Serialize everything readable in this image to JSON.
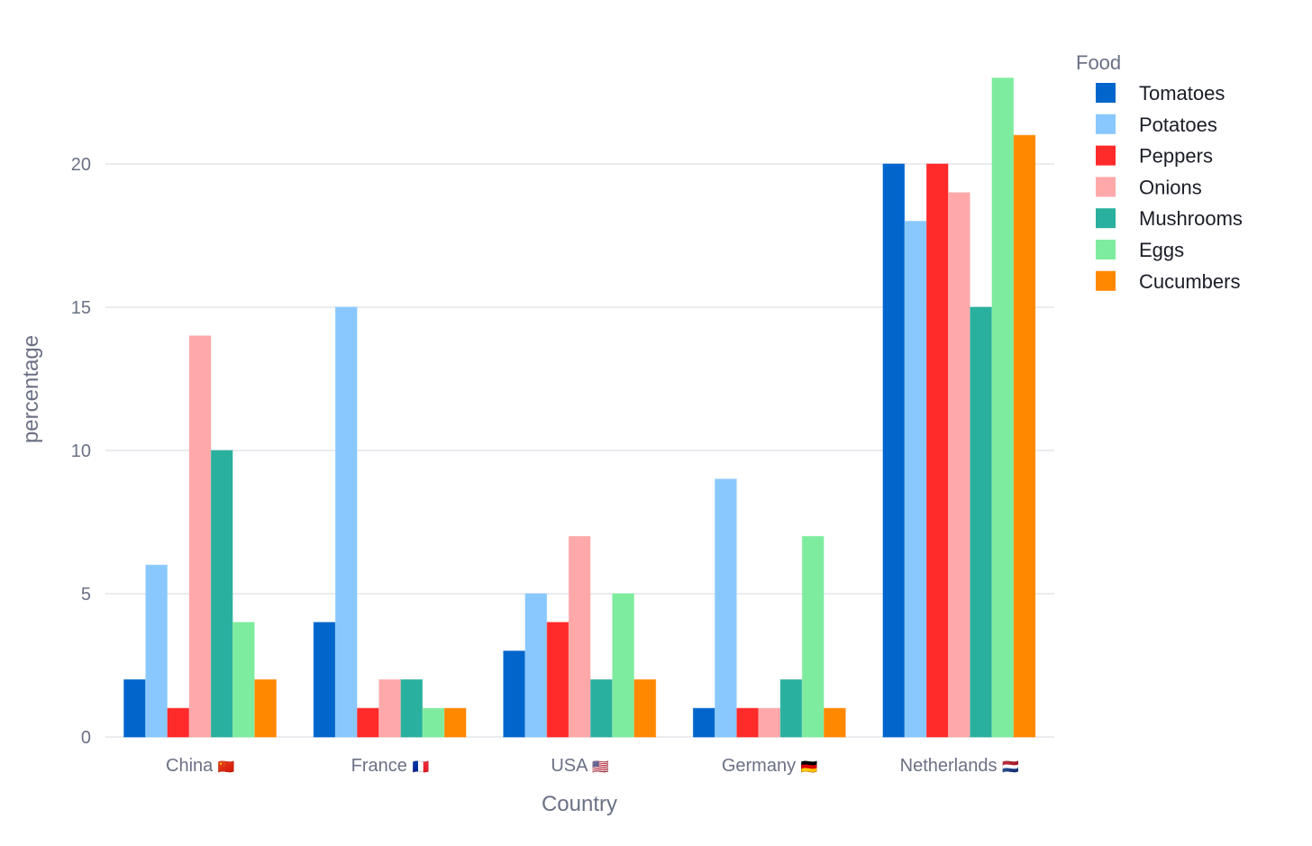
{
  "chart_data": {
    "type": "bar",
    "title": "",
    "xlabel": "Country",
    "ylabel": "percentage",
    "ylim": [
      0,
      23.5
    ],
    "yticks": [
      0,
      5,
      10,
      15,
      20
    ],
    "grid": true,
    "legend_title": "Food",
    "legend_position": "top-right",
    "categories": [
      "China",
      "France",
      "USA",
      "Germany",
      "Netherlands"
    ],
    "category_flags": [
      "🇨🇳",
      "🇫🇷",
      "🇺🇸",
      "🇩🇪",
      "🇳🇱"
    ],
    "series": [
      {
        "name": "Tomatoes",
        "color": "#0066cc",
        "values": [
          2,
          4,
          3,
          1,
          20
        ]
      },
      {
        "name": "Potatoes",
        "color": "#88c8ff",
        "values": [
          6,
          15,
          5,
          9,
          18
        ]
      },
      {
        "name": "Peppers",
        "color": "#ff2a2a",
        "values": [
          1,
          1,
          4,
          1,
          20
        ]
      },
      {
        "name": "Onions",
        "color": "#ffa8aa",
        "values": [
          14,
          2,
          7,
          1,
          19
        ]
      },
      {
        "name": "Mushrooms",
        "color": "#2ab09e",
        "values": [
          10,
          2,
          2,
          2,
          15
        ]
      },
      {
        "name": "Eggs",
        "color": "#7eec9e",
        "values": [
          4,
          1,
          5,
          7,
          23
        ]
      },
      {
        "name": "Cucumbers",
        "color": "#ff8800",
        "values": [
          2,
          1,
          2,
          1,
          21
        ]
      }
    ]
  }
}
